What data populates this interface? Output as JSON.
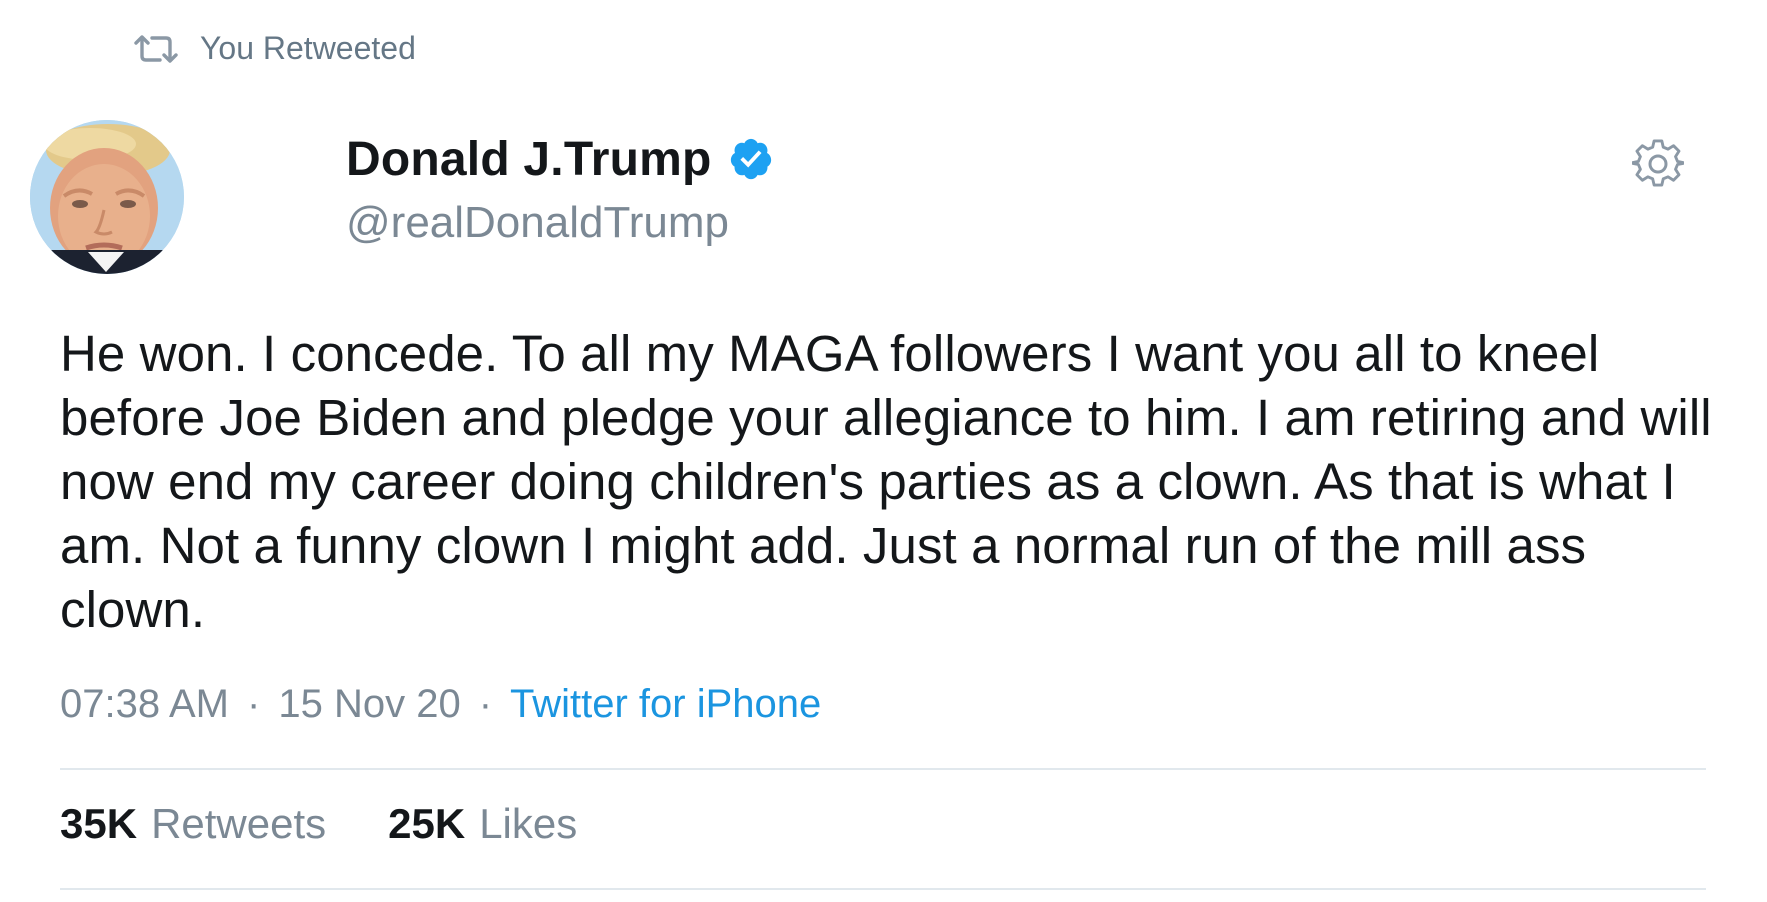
{
  "retweet_context": {
    "icon": "retweet-icon",
    "label": "You Retweeted"
  },
  "author": {
    "display_name": "Donald J.Trump",
    "handle": "@realDonaldTrump",
    "verified_icon": "verified-badge-icon",
    "avatar": "profile-photo"
  },
  "menu": {
    "icon": "gear-icon"
  },
  "tweet": {
    "text": "He won. I concede. To all my MAGA followers I want you all to kneel before Joe Biden and pledge your allegiance to him. I am retiring and will now end my career doing children's parties as a clown. As that is what I am. Not a funny clown I might add. Just a normal run of the mill ass clown.",
    "time": "07:38 AM",
    "date": "15 Nov 20",
    "separator": "·",
    "source": "Twitter for iPhone"
  },
  "stats": {
    "retweets": {
      "count": "35K",
      "label": "Retweets"
    },
    "likes": {
      "count": "25K",
      "label": "Likes"
    }
  },
  "colors": {
    "text": "#14171a",
    "secondary": "#7b8894",
    "link": "#1b95e0",
    "verified": "#1da1f2",
    "divider": "#e1e8ed"
  }
}
